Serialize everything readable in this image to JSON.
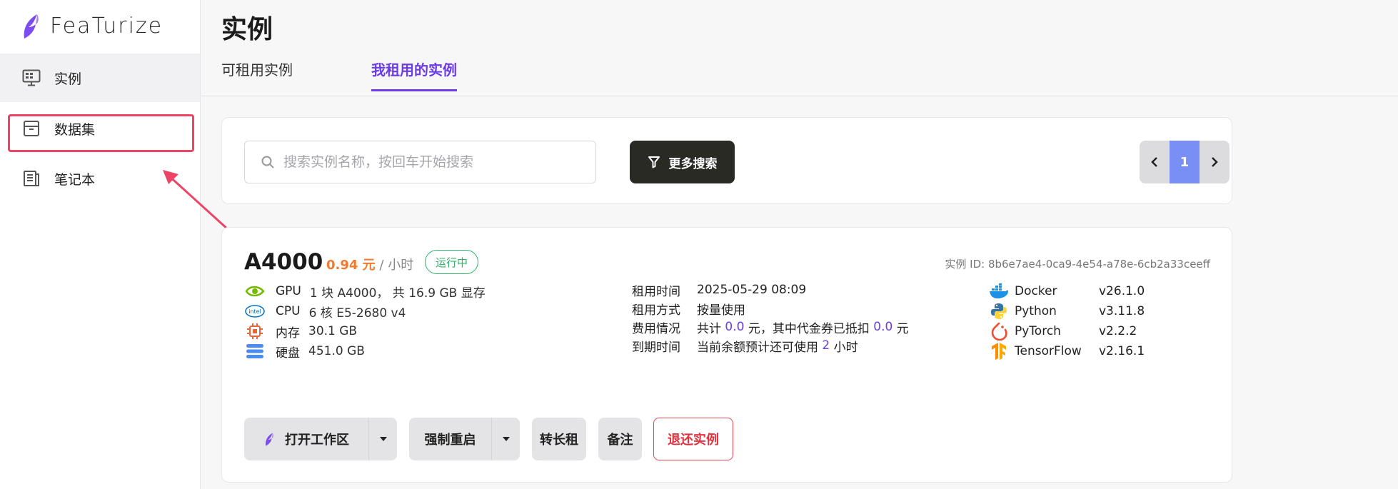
{
  "app": {
    "logo_text": "FeaTurize"
  },
  "sidebar": {
    "items": [
      {
        "label": "实例",
        "icon": "monitor-icon"
      },
      {
        "label": "数据集",
        "icon": "archive-icon"
      },
      {
        "label": "笔记本",
        "icon": "notebook-icon"
      }
    ]
  },
  "page": {
    "title": "实例",
    "tabs": [
      {
        "label": "可租用实例",
        "active": false
      },
      {
        "label": "我租用的实例",
        "active": true
      }
    ]
  },
  "search": {
    "placeholder": "搜索实例名称，按回车开始搜索",
    "more_label": "更多搜索"
  },
  "pagination": {
    "current": "1"
  },
  "instance": {
    "gpu_model": "A4000",
    "price": "0.94 元",
    "price_unit": " / 小时",
    "status": "运行中",
    "id_text": "实例 ID: 8b6e7ae4-0ca9-4e54-a78e-6cb2a33ceeff",
    "specs": [
      {
        "label": "GPU",
        "value": "1 块 A4000， 共 16.9 GB 显存",
        "icon": "nvidia-icon"
      },
      {
        "label": "CPU",
        "value": "6 核 E5-2680 v4",
        "icon": "intel-icon"
      },
      {
        "label": "内存",
        "value": "30.1 GB",
        "icon": "memory-chip-icon"
      },
      {
        "label": "硬盘",
        "value": "451.0 GB",
        "icon": "disk-icon"
      }
    ],
    "rental": {
      "time_label": "租用时间",
      "time_value": "2025-05-29 08:09",
      "mode_label": "租用方式",
      "mode_value": "按量使用",
      "cost_label": "费用情况",
      "cost_prefix": "共计 ",
      "cost_total": "0.0",
      "cost_mid": " 元，其中代金券已抵扣 ",
      "cost_voucher": "0.0",
      "cost_suffix": " 元",
      "expire_label": "到期时间",
      "expire_prefix": "当前余额预计还可使用 ",
      "expire_hours": "2",
      "expire_suffix": " 小时"
    },
    "software": [
      {
        "name": "Docker",
        "version": "v26.1.0",
        "icon": "docker-icon"
      },
      {
        "name": "Python",
        "version": "v3.11.8",
        "icon": "python-icon"
      },
      {
        "name": "PyTorch",
        "version": "v2.2.2",
        "icon": "pytorch-icon"
      },
      {
        "name": "TensorFlow",
        "version": "v2.16.1",
        "icon": "tensorflow-icon"
      }
    ],
    "actions": {
      "open_workspace": "打开工作区",
      "force_restart": "强制重启",
      "long_term": "转长租",
      "note": "备注",
      "return": "退还实例"
    }
  },
  "colors": {
    "accent": "#6c3ce8",
    "price": "#f07a2e",
    "status": "#2db468",
    "danger": "#e03440",
    "highlight": "#ec4465"
  }
}
